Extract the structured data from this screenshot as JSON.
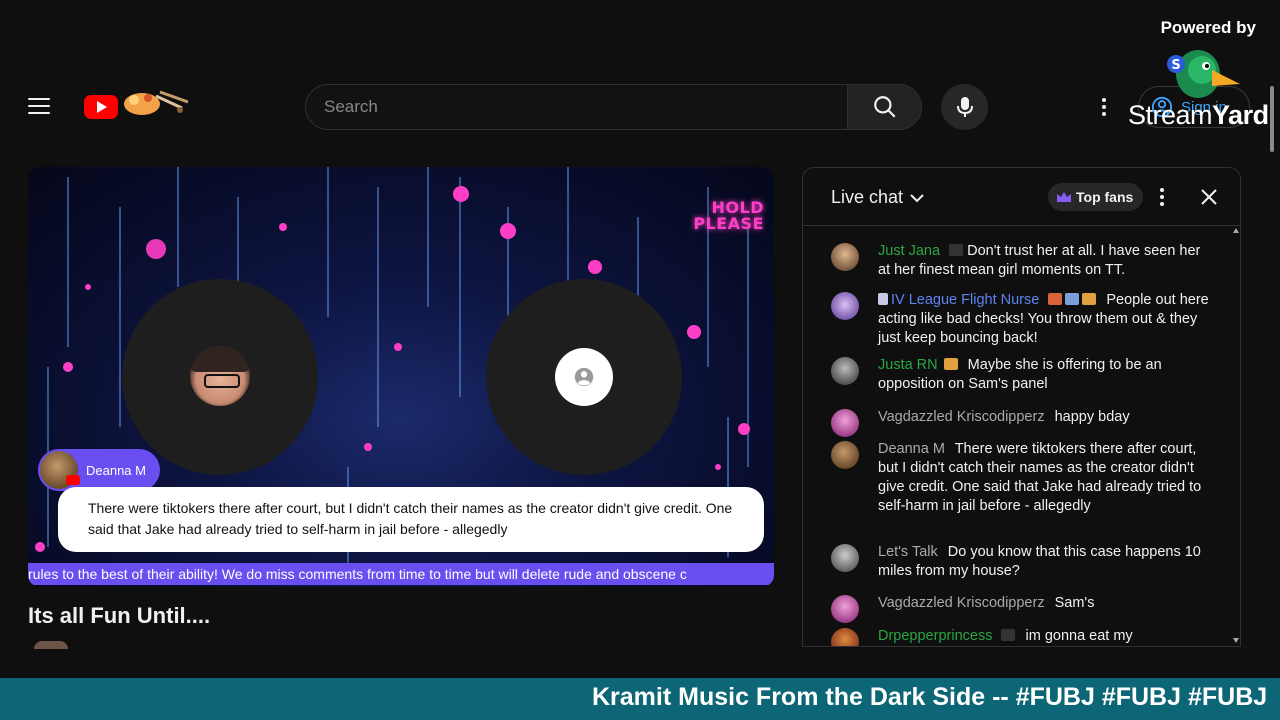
{
  "header": {
    "search_placeholder": "Search",
    "signin_label": "Sign in"
  },
  "overlay": {
    "powered_by": "Powered by",
    "streamyard_part1": "Stream",
    "streamyard_part2": "Yard"
  },
  "video": {
    "hold_line1": "HOLD",
    "hold_line2": "PLEASE",
    "commenter_name": "Deanna M",
    "comment_text": "There were tiktokers there after court, but I didn't catch their names as the creator didn't give credit. One said that Jake had already tried to self-harm in jail before - allegedly",
    "ticker_text": "rules to the best of their ability! We do miss comments from time to time but will delete rude and obscene c",
    "title": "Its all Fun Until...."
  },
  "chat": {
    "title": "Live chat",
    "top_fans_label": "Top fans",
    "messages": [
      {
        "author": "Just Jana",
        "text": "Don't trust her at all. I have seen her at her finest mean girl moments on TT.",
        "color": "#2ba640"
      },
      {
        "author": "IV League Flight Nurse",
        "text": "People out here acting like bad checks! You throw them out & they just keep bouncing back!",
        "color": "#5e84f1"
      },
      {
        "author": "Justa RN",
        "text": "Maybe she is offering to be an opposition on Sam's panel",
        "color": "#2ba640"
      },
      {
        "author": "Vagdazzled Kriscodipperz",
        "text": "happy bday",
        "color": "#aaaaaa"
      },
      {
        "author": "Deanna M",
        "text": "There were tiktokers there after court, but I didn't catch their names as the creator didn't give credit. One said that Jake had already tried to self-harm in jail before - allegedly",
        "color": "#aaaaaa"
      },
      {
        "author": "Let's Talk",
        "text": "Do you know that this case happens 10 miles from my house?",
        "color": "#aaaaaa"
      },
      {
        "author": "Vagdazzled Kriscodipperz",
        "text": "Sam's",
        "color": "#aaaaaa"
      },
      {
        "author": "Drpepperprincess",
        "text": "im gonna eat my",
        "color": "#2ba640"
      }
    ]
  },
  "banner": {
    "text": "Kramit Music From the Dark Side -- #FUBJ #FUBJ #FUBJ"
  },
  "colors": {
    "accent_purple": "#6a4ef0",
    "banner_teal": "#0d6676",
    "youtube_red": "#ff0000"
  }
}
